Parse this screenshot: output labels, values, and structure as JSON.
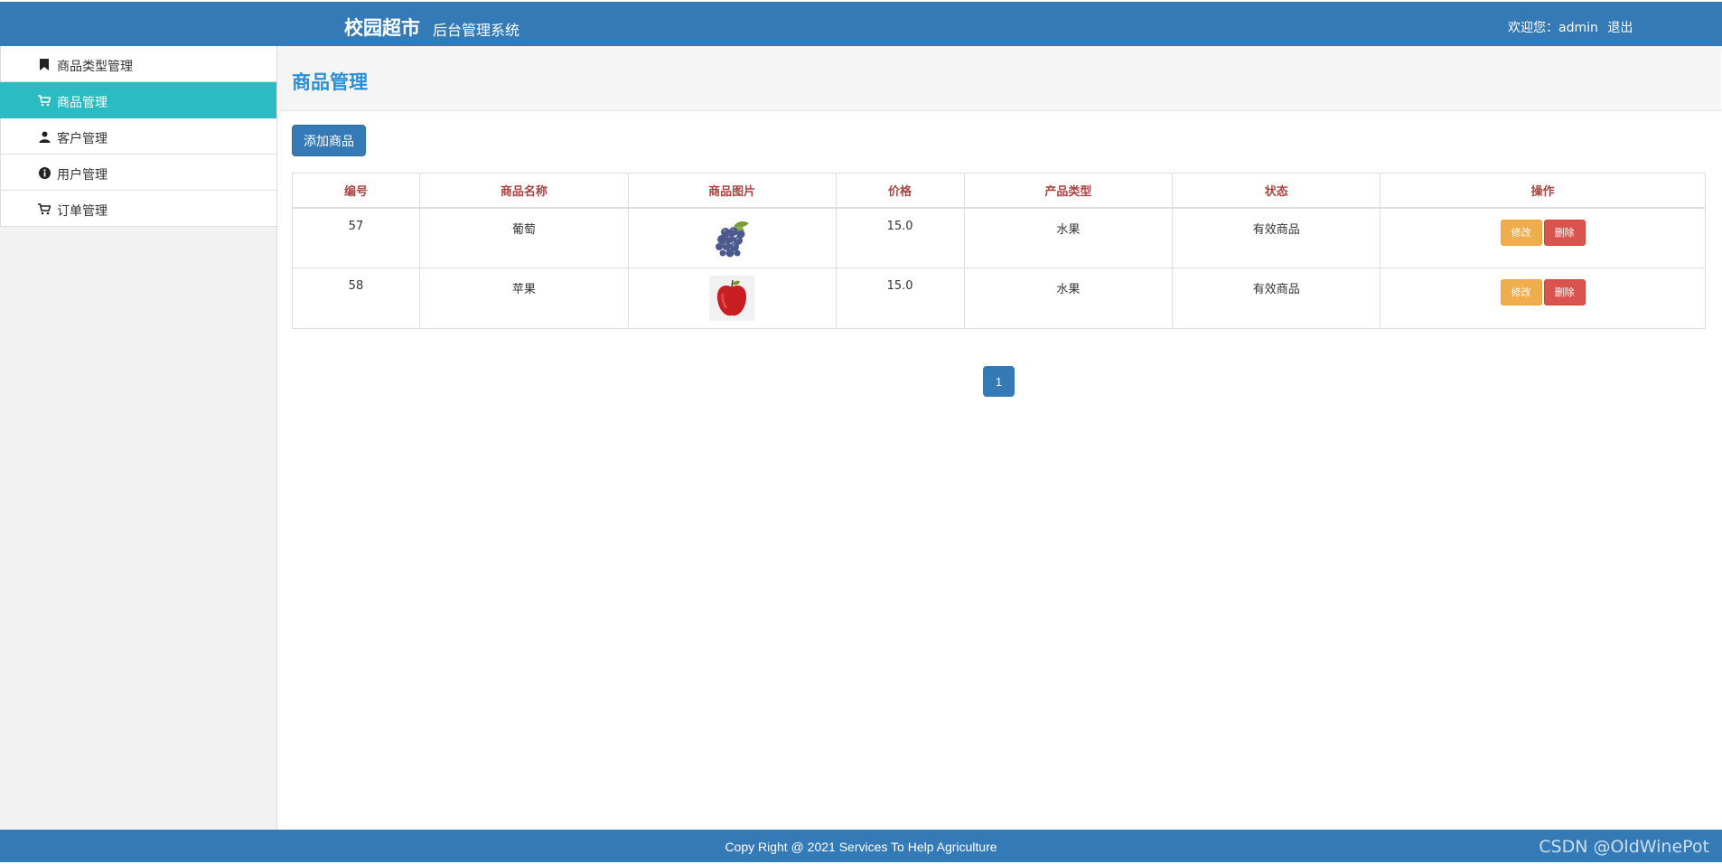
{
  "header": {
    "brand": "校园超市",
    "subtitle": "后台管理系统",
    "welcome_prefix": "欢迎您：",
    "username": "admin",
    "logout": "退出"
  },
  "sidebar": {
    "items": [
      {
        "label": "商品类型管理",
        "icon": "bookmark-icon"
      },
      {
        "label": "商品管理",
        "icon": "cart-icon",
        "active": true
      },
      {
        "label": "客户管理",
        "icon": "user-icon"
      },
      {
        "label": "用户管理",
        "icon": "info-icon"
      },
      {
        "label": "订单管理",
        "icon": "cart-icon"
      }
    ]
  },
  "main": {
    "title": "商品管理",
    "add_button": "添加商品",
    "table": {
      "headers": [
        "编号",
        "商品名称",
        "商品图片",
        "价格",
        "产品类型",
        "状态",
        "操作"
      ],
      "rows": [
        {
          "id": "57",
          "name": "葡萄",
          "image": "grape-thumbnail",
          "price": "15.0",
          "type": "水果",
          "status": "有效商品",
          "edit": "修改",
          "delete": "删除"
        },
        {
          "id": "58",
          "name": "苹果",
          "image": "apple-thumbnail",
          "price": "15.0",
          "type": "水果",
          "status": "有效商品",
          "edit": "修改",
          "delete": "删除"
        }
      ]
    },
    "pagination": {
      "current": "1"
    }
  },
  "footer": {
    "copyright": "Copy Right @ 2021 Services To Help Agriculture",
    "watermark": "CSDN @OldWinePot"
  },
  "colors": {
    "primary": "#337ab7",
    "active_nav": "#2bbbc2",
    "title": "#2a8fd6",
    "table_header": "#a94442",
    "edit": "#f0ad4e",
    "delete": "#d9534f"
  }
}
